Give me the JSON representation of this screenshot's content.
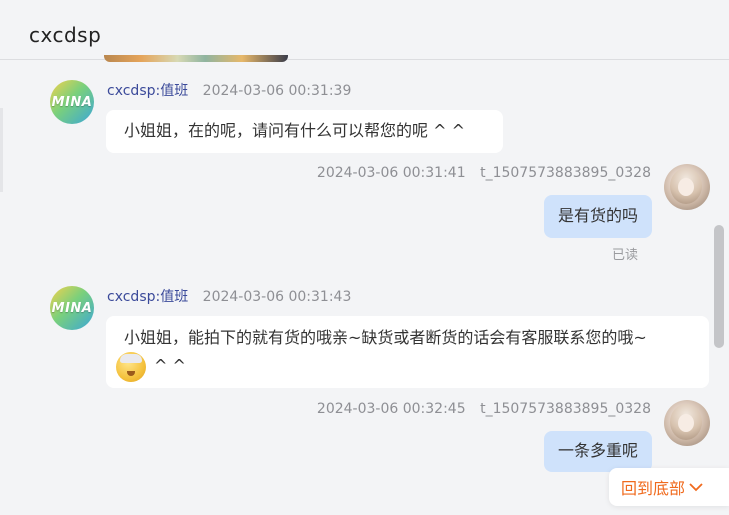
{
  "header": {
    "title": "cxcdsp"
  },
  "messages": [
    {
      "side": "agent",
      "avatar_text": "MINA",
      "sender": "cxcdsp:值班",
      "time": "2024-03-06 00:31:39",
      "text": "小姐姐，在的呢，请问有什么可以帮您的呢 ^ ^"
    },
    {
      "side": "user",
      "time": "2024-03-06 00:31:41",
      "user_id": "t_1507573883895_0328",
      "text": "是有货的吗",
      "status": "已读"
    },
    {
      "side": "agent",
      "avatar_text": "MINA",
      "sender": "cxcdsp:值班",
      "time": "2024-03-06 00:31:43",
      "text_line1": "小姐姐，能拍下的就有货的哦亲~缺货或者断货的话会有客服联系您的哦~",
      "text_line2": "^ ^",
      "emoji": "halo-smile-emoji"
    },
    {
      "side": "user",
      "time": "2024-03-06 00:32:45",
      "user_id": "t_1507573883895_0328",
      "text": "一条多重呢"
    }
  ],
  "back_to_bottom": {
    "label": "回到底部",
    "icon": "chevron-down-icon"
  },
  "colors": {
    "background": "#f3f4f6",
    "agent_bubble": "#ffffff",
    "user_bubble": "#cfe2fb",
    "sender_name": "#3b4a9a",
    "accent_orange": "#f06a1d"
  }
}
